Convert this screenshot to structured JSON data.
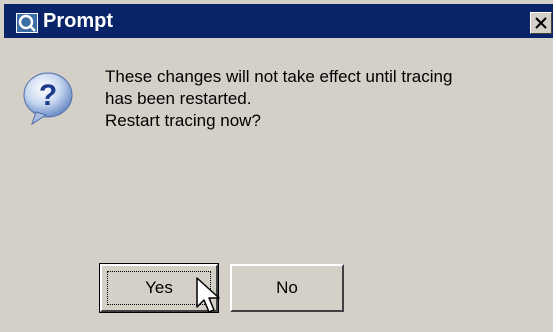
{
  "window": {
    "title": "Prompt",
    "app_icon": "prompt-app-icon",
    "close_icon": "close-icon"
  },
  "message": {
    "icon": "question-icon",
    "line1": "These changes will not take effect until tracing",
    "line2": "has been restarted.",
    "line3": "Restart tracing now?"
  },
  "buttons": {
    "yes_label": "Yes",
    "no_label": "No"
  },
  "colors": {
    "titlebar": "#0a246a",
    "dialog_face": "#d4d0c8",
    "title_text": "#ffffff"
  }
}
